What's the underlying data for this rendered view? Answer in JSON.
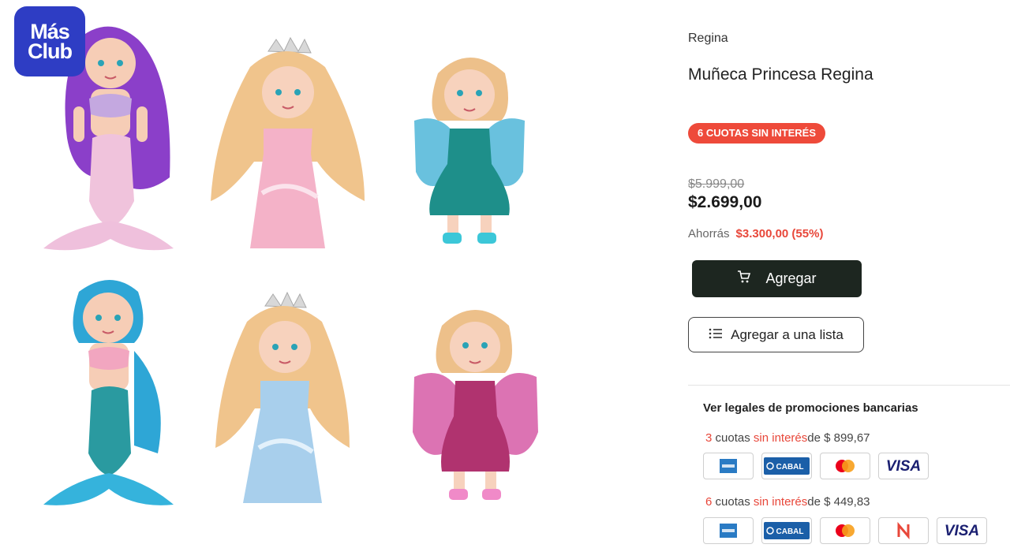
{
  "logo": {
    "line1": "Más",
    "line2": "Club"
  },
  "product": {
    "brand": "Regina",
    "title": "Muñeca Princesa Regina",
    "badge": "6 CUOTAS SIN INTERÉS",
    "old_price": "$5.999,00",
    "price": "$2.699,00",
    "savings_label": "Ahorrás",
    "savings_amount": "$3.300,00 (55%)"
  },
  "actions": {
    "add_label": "Agregar",
    "list_label": "Agregar a una lista"
  },
  "promotions": {
    "title": "Ver legales de promociones bancarias",
    "plans": [
      {
        "count": "3",
        "cuotas": "cuotas",
        "sin_interes": "sin interés",
        "de": "de $ 899,67",
        "cards": [
          "amex-card-icon",
          "cabal-card-icon",
          "mastercard-icon",
          "visa-card-icon"
        ]
      },
      {
        "count": "6",
        "cuotas": "cuotas",
        "sin_interes": "sin interés",
        "de": "de $ 449,83",
        "cards": [
          "amex-card-icon",
          "cabal-card-icon",
          "mastercard-icon",
          "naranja-card-icon",
          "visa-card-icon"
        ]
      }
    ],
    "card_labels": {
      "cabal": "CABAL",
      "visa": "VISA"
    }
  },
  "colors": {
    "accent_red": "#ee4a3a",
    "logo_blue": "#2e3dc4",
    "button_dark": "#1d2620"
  }
}
